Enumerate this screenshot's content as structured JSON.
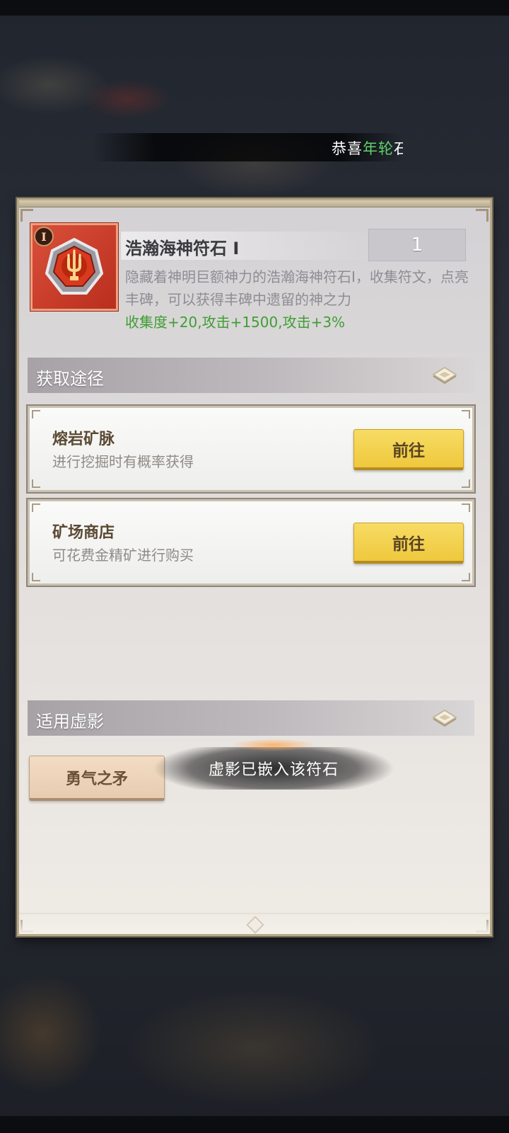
{
  "ticker": {
    "prefix": "恭喜",
    "highlight": "年轮",
    "suffix": "石"
  },
  "item": {
    "grade": "I",
    "name": "浩瀚海神符石 Ⅰ",
    "count": "1",
    "description": "隐藏着神明巨额神力的浩瀚海神符石Ⅰ，收集符文，点亮丰碑，可以获得丰碑中遗留的神之力",
    "stats": "收集度+20,攻击+1500,攻击+3%",
    "icon": "trident-rune-icon"
  },
  "sources": {
    "title": "获取途径",
    "items": [
      {
        "title": "熔岩矿脉",
        "desc": "进行挖掘时有概率获得",
        "button": "前往"
      },
      {
        "title": "矿场商店",
        "desc": "可花费金精矿进行购买",
        "button": "前往"
      }
    ]
  },
  "phantom": {
    "title": "适用虚影",
    "items": [
      {
        "label": "勇气之矛"
      }
    ]
  },
  "toast": {
    "text": "虚影已嵌入该符石"
  },
  "colors": {
    "stats_green": "#3f9e33",
    "button_yellow": "#efc83d",
    "item_red": "#c93a25"
  }
}
